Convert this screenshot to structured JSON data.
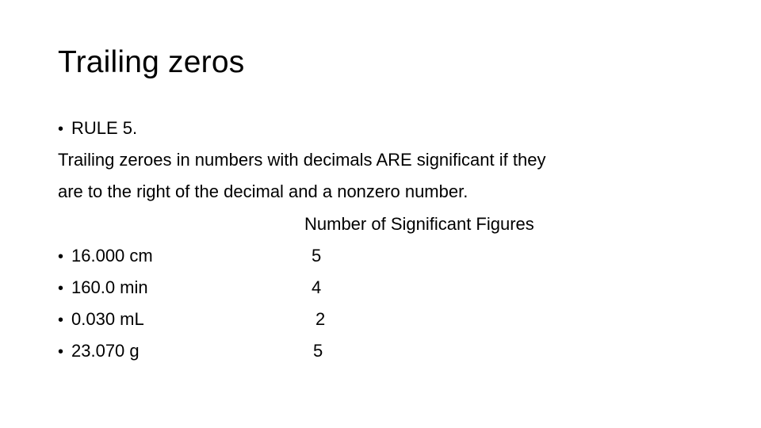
{
  "slide": {
    "title": "Trailing zeros",
    "rule_label": "RULE 5.",
    "description_lines": [
      "Trailing zeroes in numbers with decimals ARE significant if they",
      "are to the right of the decimal and a nonzero number."
    ],
    "column_header": "Number of Significant Figures",
    "examples": [
      {
        "value": "16.000 cm",
        "sig_figs": "5"
      },
      {
        "value": "160.0 min",
        "sig_figs": "4"
      },
      {
        "value": "0.030 mL",
        "sig_figs": "2"
      },
      {
        "value": "23.070 g",
        "sig_figs": "5"
      }
    ]
  }
}
